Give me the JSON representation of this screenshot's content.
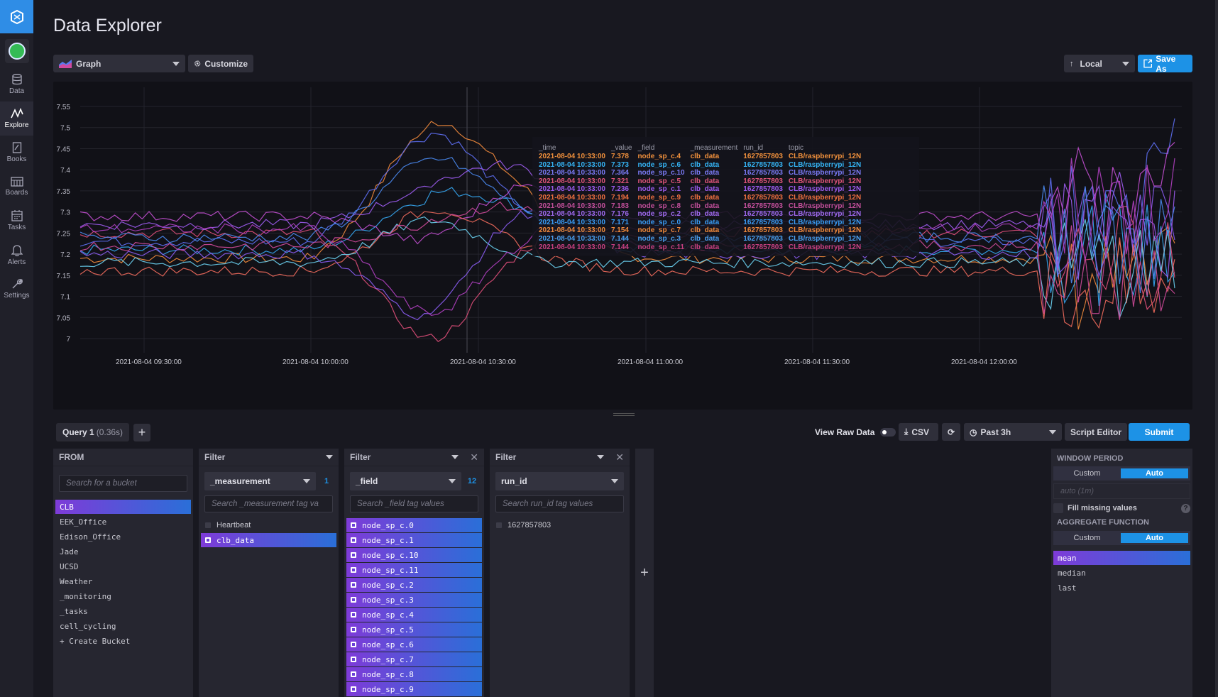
{
  "nav": {
    "items": [
      {
        "label": "Data",
        "icon": "database-icon"
      },
      {
        "label": "Explore",
        "icon": "graph-icon"
      },
      {
        "label": "Books",
        "icon": "notebook-icon"
      },
      {
        "label": "Boards",
        "icon": "dashboard-icon"
      },
      {
        "label": "Tasks",
        "icon": "calendar-icon"
      },
      {
        "label": "Alerts",
        "icon": "bell-icon"
      },
      {
        "label": "Settings",
        "icon": "wrench-icon"
      }
    ]
  },
  "header": {
    "title": "Data Explorer",
    "view_type": "Graph",
    "customize": "Customize",
    "timezone": "Local",
    "save_as": "Save As"
  },
  "chart_data": {
    "type": "line",
    "ylim": [
      7,
      7.55
    ],
    "yticks": [
      "7.55",
      "7.5",
      "7.45",
      "7.4",
      "7.35",
      "7.3",
      "7.25",
      "7.2",
      "7.15",
      "7.1",
      "7.05",
      "7"
    ],
    "xticks": [
      "2021-08-04 09:30:00",
      "2021-08-04 10:00:00",
      "2021-08-04 10:30:00",
      "2021-08-04 11:00:00",
      "2021-08-04 11:30:00",
      "2021-08-04 12:00:00"
    ],
    "series_colors": [
      "#f08a3c",
      "#35a6f0",
      "#5d6ef0",
      "#e04f7a",
      "#9d5cf0",
      "#c24fd0",
      "#f06a5c",
      "#6ad0f0",
      "#8a5cf0",
      "#d04a9a",
      "#4a8af0",
      "#b040c0"
    ],
    "tooltip": {
      "headers": [
        "_time",
        "_value",
        "_field",
        "_measurement",
        "run_id",
        "topic"
      ],
      "rows": [
        {
          "time": "2021-08-04 10:33:00",
          "value": "7.378",
          "field": "node_sp_c.4",
          "measurement": "clb_data",
          "run_id": "1627857803",
          "topic": "CLB/raspberrypi_12N",
          "color": "#f0903c"
        },
        {
          "time": "2021-08-04 10:33:00",
          "value": "7.373",
          "field": "node_sp_c.6",
          "measurement": "clb_data",
          "run_id": "1627857803",
          "topic": "CLB/raspberrypi_12N",
          "color": "#35b4f5"
        },
        {
          "time": "2021-08-04 10:33:00",
          "value": "7.364",
          "field": "node_sp_c.10",
          "measurement": "clb_data",
          "run_id": "1627857803",
          "topic": "CLB/raspberrypi_12N",
          "color": "#7a7af5"
        },
        {
          "time": "2021-08-04 10:33:00",
          "value": "7.321",
          "field": "node_sp_c.5",
          "measurement": "clb_data",
          "run_id": "1627857803",
          "topic": "CLB/raspberrypi_12N",
          "color": "#e0557a"
        },
        {
          "time": "2021-08-04 10:33:00",
          "value": "7.236",
          "field": "node_sp_c.1",
          "measurement": "clb_data",
          "run_id": "1627857803",
          "topic": "CLB/raspberrypi_12N",
          "color": "#9d5cf0"
        },
        {
          "time": "2021-08-04 10:33:00",
          "value": "7.194",
          "field": "node_sp_c.9",
          "measurement": "clb_data",
          "run_id": "1627857803",
          "topic": "CLB/raspberrypi_12N",
          "color": "#f07040"
        },
        {
          "time": "2021-08-04 10:33:00",
          "value": "7.183",
          "field": "node_sp_c.8",
          "measurement": "clb_data",
          "run_id": "1627857803",
          "topic": "CLB/raspberrypi_12N",
          "color": "#c24f9a"
        },
        {
          "time": "2021-08-04 10:33:00",
          "value": "7.176",
          "field": "node_sp_c.2",
          "measurement": "clb_data",
          "run_id": "1627857803",
          "topic": "CLB/raspberrypi_12N",
          "color": "#a06af0"
        },
        {
          "time": "2021-08-04 10:33:00",
          "value": "7.171",
          "field": "node_sp_c.0",
          "measurement": "clb_data",
          "run_id": "1627857803",
          "topic": "CLB/raspberrypi_12N",
          "color": "#3a9cf5"
        },
        {
          "time": "2021-08-04 10:33:00",
          "value": "7.154",
          "field": "node_sp_c.7",
          "measurement": "clb_data",
          "run_id": "1627857803",
          "topic": "CLB/raspberrypi_12N",
          "color": "#f08a3c"
        },
        {
          "time": "2021-08-04 10:33:00",
          "value": "7.144",
          "field": "node_sp_c.3",
          "measurement": "clb_data",
          "run_id": "1627857803",
          "topic": "CLB/raspberrypi_12N",
          "color": "#4aa0f0"
        },
        {
          "time": "2021-08-04 10:33:00",
          "value": "7.144",
          "field": "node_sp_c.11",
          "measurement": "clb_data",
          "run_id": "1627857803",
          "topic": "CLB/raspberrypi_12N",
          "color": "#c84080"
        }
      ]
    }
  },
  "query": {
    "tab_label": "Query 1",
    "tab_time": "(0.36s)",
    "view_raw": "View Raw Data",
    "csv": "CSV",
    "time_range": "Past 3h",
    "script_editor": "Script Editor",
    "submit": "Submit"
  },
  "from": {
    "title": "FROM",
    "search_placeholder": "Search for a bucket",
    "buckets": [
      "CLB",
      "EEK_Office",
      "Edison_Office",
      "Jade",
      "UCSD",
      "Weather",
      "_monitoring",
      "_tasks",
      "cell_cycling",
      "+ Create Bucket"
    ]
  },
  "filter1": {
    "title": "Filter",
    "key": "_measurement",
    "count": "1",
    "search_placeholder": "Search _measurement tag va",
    "values": [
      "Heartbeat",
      "clb_data"
    ]
  },
  "filter2": {
    "title": "Filter",
    "key": "_field",
    "count": "12",
    "search_placeholder": "Search _field tag values",
    "values": [
      "node_sp_c.0",
      "node_sp_c.1",
      "node_sp_c.10",
      "node_sp_c.11",
      "node_sp_c.2",
      "node_sp_c.3",
      "node_sp_c.4",
      "node_sp_c.5",
      "node_sp_c.6",
      "node_sp_c.7",
      "node_sp_c.8",
      "node_sp_c.9"
    ]
  },
  "filter3": {
    "title": "Filter",
    "key": "run_id",
    "search_placeholder": "Search run_id tag values",
    "values": [
      "1627857803"
    ]
  },
  "window": {
    "title": "WINDOW PERIOD",
    "custom": "Custom",
    "auto": "Auto",
    "placeholder": "auto (1m)",
    "fill_missing": "Fill missing values",
    "agg_title": "AGGREGATE FUNCTION",
    "agg_custom": "Custom",
    "agg_auto": "Auto",
    "functions": [
      "mean",
      "median",
      "last"
    ]
  }
}
